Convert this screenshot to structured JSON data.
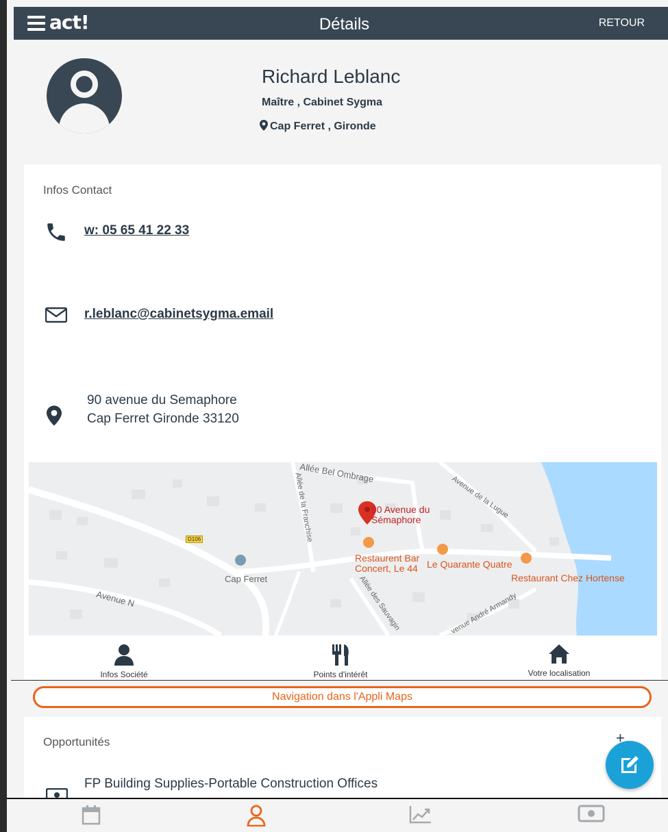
{
  "header": {
    "logo": "act!",
    "title": "Détails",
    "back_label": "RETOUR"
  },
  "profile": {
    "name": "Richard Leblanc",
    "job": "Maître , Cabinet Sygma",
    "location": "Cap Ferret , Gironde"
  },
  "contact": {
    "section_title": "Infos Contact",
    "phone": "w: 05 65 41 22 33",
    "email": "r.leblanc@cabinetsygma.email",
    "address_line1": "90 avenue du Semaphore",
    "address_line2": "Cap Ferret Gironde 33120"
  },
  "map": {
    "pin_label_line1": "90 Avenue du",
    "pin_label_line2": "Sémaphore",
    "labels": {
      "allee_bel_ombrage": "Allée Bel Ombrage",
      "allee_franchise": "Allée de la Franchise",
      "avenue_lugue": "Avenue de la Lugue",
      "d106": "D106",
      "cap_ferret": "Cap Ferret",
      "avenue_n": "Avenue N",
      "allee_sauvagine": "Allée des Sauvagin",
      "avenue_andre": "venue André Armandy"
    },
    "pois": {
      "restaurant_bar_line1": "Restaurent Bar",
      "restaurant_bar_line2": "Concert, Le 44",
      "quarante_quatre": "Le Quarante Quatre",
      "chez_hortense": "Restaurant Chez Hortense"
    }
  },
  "actions": {
    "company": "Infos Société",
    "poi": "Points d'intérêt",
    "location": "Votre localisation"
  },
  "maps_nav_label": "Navigation dans l'Appli Maps",
  "opportunities": {
    "section_title": "Opportunités",
    "plus": "+",
    "first_item": "FP Building Supplies-Portable Construction Offices"
  },
  "bottom_nav": {
    "items": [
      "calendar-icon",
      "contact-icon",
      "chart-icon",
      "money-icon"
    ],
    "active_index": 1,
    "active_color": "#e8641a"
  },
  "colors": {
    "header_bg": "#384753",
    "accent": "#e8641a",
    "fab": "#1aa1d8",
    "water": "#aadaff",
    "map_pin": "#d93025"
  }
}
